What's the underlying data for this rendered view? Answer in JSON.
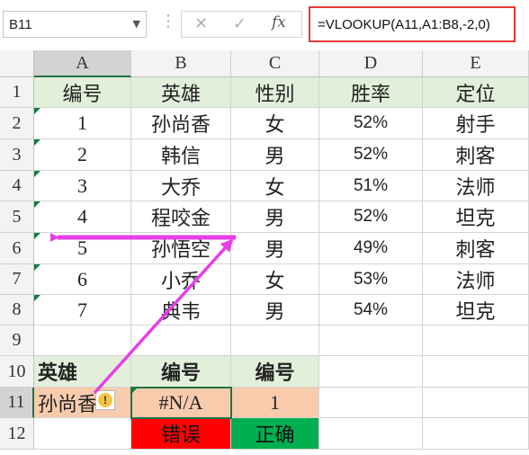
{
  "formula_bar": {
    "name_box": "B11",
    "cancel_icon": "✕",
    "enter_icon": "✓",
    "fx_label": "fx",
    "formula": "=VLOOKUP(A11,A1:B8,-2,0)"
  },
  "columns": [
    "A",
    "B",
    "C",
    "D",
    "E"
  ],
  "rows": [
    "1",
    "2",
    "3",
    "4",
    "5",
    "6",
    "7",
    "8",
    "9",
    "10",
    "11",
    "12"
  ],
  "table": {
    "headers": [
      "编号",
      "英雄",
      "性别",
      "胜率",
      "定位"
    ],
    "data": [
      [
        "1",
        "孙尚香",
        "女",
        "52%",
        "射手"
      ],
      [
        "2",
        "韩信",
        "男",
        "52%",
        "刺客"
      ],
      [
        "3",
        "大乔",
        "女",
        "51%",
        "法师"
      ],
      [
        "4",
        "程咬金",
        "男",
        "52%",
        "坦克"
      ],
      [
        "5",
        "孙悟空",
        "男",
        "49%",
        "刺客"
      ],
      [
        "6",
        "小乔",
        "女",
        "53%",
        "法师"
      ],
      [
        "7",
        "典韦",
        "男",
        "54%",
        "坦克"
      ]
    ]
  },
  "lookup": {
    "headers": [
      "英雄",
      "编号",
      "编号"
    ],
    "hero": "孙尚香",
    "result_error": "#N/A",
    "result_ok": "1",
    "label_error": "错误",
    "label_ok": "正确"
  },
  "warning_icon": "!",
  "colors": {
    "header_green": "#e2efda",
    "peach": "#f8cbad",
    "error_red": "#ff0000",
    "ok_green": "#00b050",
    "arrow_magenta": "#e83ee8",
    "formula_border": "#e53935"
  }
}
